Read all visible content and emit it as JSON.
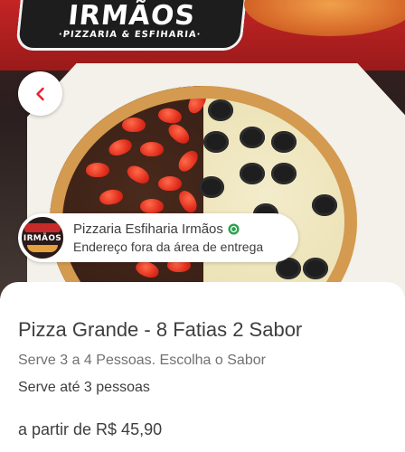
{
  "hero": {
    "banner_brand": "IRMÃOS",
    "banner_tagline": "·PIZZARIA & ESFIHARIA·",
    "image_icon": "pizza-photo"
  },
  "back_button": {
    "icon": "chevron-left-icon",
    "color": "#EA1D2C"
  },
  "store": {
    "name": "Pizzaria Esfiharia Irmãos",
    "verified_icon": "verified-badge-icon",
    "verified_color": "#2BA24C",
    "delivery_status": "Endereço fora da área de entrega",
    "logo_text": "IRMÃOS"
  },
  "product": {
    "title": "Pizza Grande - 8 Fatias 2 Sabor",
    "description": "Serve 3 a 4 Pessoas. Escolha o Sabor",
    "serves": "Serve até 3 pessoas",
    "price": "a partir de R$ 45,90"
  }
}
